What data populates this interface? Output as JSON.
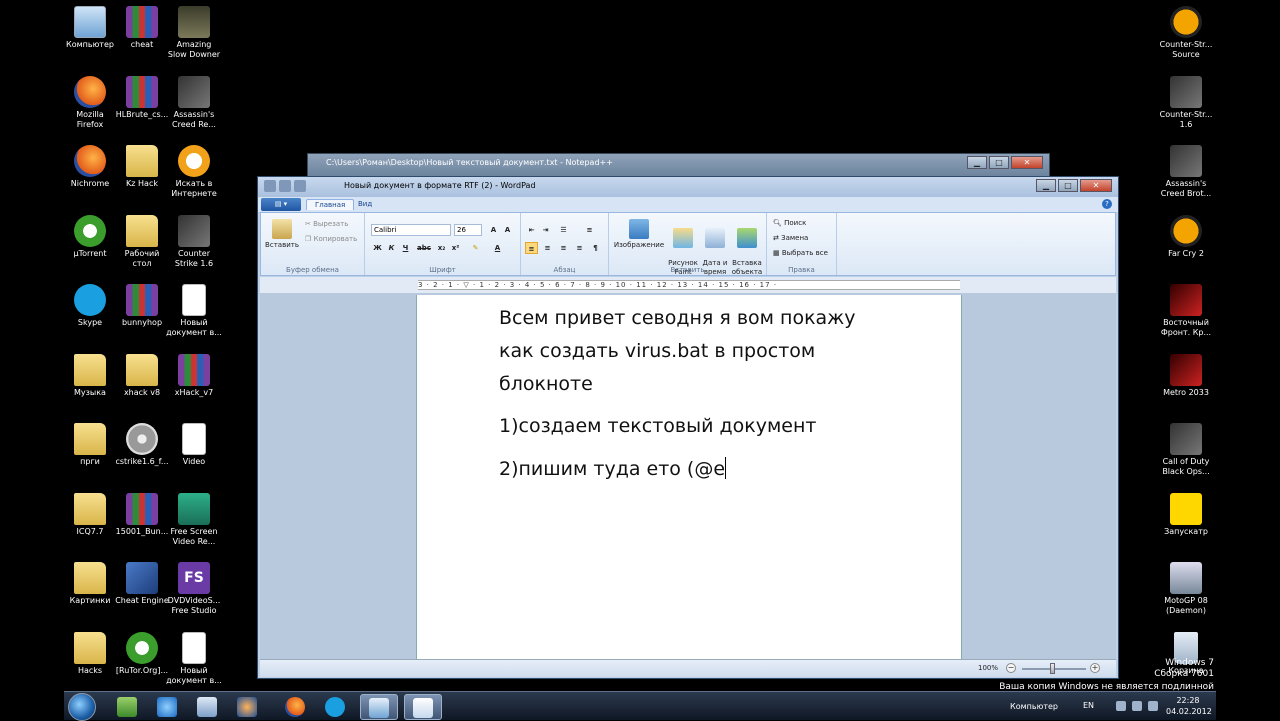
{
  "desktop_icons_left": [
    {
      "label": "Компьютер",
      "icon": "computer-icon"
    },
    {
      "label": "cheat",
      "icon": "winrar-archive-icon"
    },
    {
      "label": "Amazing\nSlow Downer",
      "icon": "amazing-slow-downer-icon"
    },
    {
      "label": "Mozilla\nFirefox",
      "icon": "firefox-icon"
    },
    {
      "label": "HLBrute_cs...",
      "icon": "winrar-archive-icon"
    },
    {
      "label": "Assassin's\nCreed Re...",
      "icon": "assassins-creed-icon"
    },
    {
      "label": "Nichrome",
      "icon": "nichrome-icon"
    },
    {
      "label": "Kz Hack",
      "icon": "folder-icon"
    },
    {
      "label": "Искать в\nИнтернете",
      "icon": "search-web-icon"
    },
    {
      "label": "µTorrent",
      "icon": "utorrent-icon"
    },
    {
      "label": "Рабочий\nстол",
      "icon": "folder-icon"
    },
    {
      "label": "Counter\nStrike 1.6",
      "icon": "counter-strike-icon"
    },
    {
      "label": "Skype",
      "icon": "skype-icon"
    },
    {
      "label": "bunnyhop",
      "icon": "winrar-archive-icon"
    },
    {
      "label": "Новый\nдокумент в...",
      "icon": "document-icon"
    },
    {
      "label": "Музыка",
      "icon": "folder-icon"
    },
    {
      "label": "xhack v8",
      "icon": "folder-icon"
    },
    {
      "label": "xHack_v7",
      "icon": "winrar-archive-icon"
    },
    {
      "label": "прги",
      "icon": "folder-icon"
    },
    {
      "label": "cstrike1.6_f...",
      "icon": "disc-icon"
    },
    {
      "label": "Video",
      "icon": "document-icon"
    },
    {
      "label": "ICQ7.7",
      "icon": "folder-icon"
    },
    {
      "label": "15001_Bun...",
      "icon": "winrar-archive-icon"
    },
    {
      "label": "Free Screen\nVideo Re...",
      "icon": "screen-recorder-icon"
    },
    {
      "label": "Картинки",
      "icon": "folder-icon"
    },
    {
      "label": "Cheat Engine",
      "icon": "cheat-engine-icon"
    },
    {
      "label": "DVDVideoS...\nFree Studio",
      "icon": "free-studio-icon"
    },
    {
      "label": "Hacks",
      "icon": "folder-icon"
    },
    {
      "label": "[RuTor.Org]...",
      "icon": "utorrent-icon"
    },
    {
      "label": "Новый\nдокумент в...",
      "icon": "document-icon"
    }
  ],
  "desktop_icons_right": [
    {
      "label": "Counter-Str...\nSource",
      "icon": "half-life-icon"
    },
    {
      "label": "Counter-Str...\n1.6",
      "icon": "counter-strike-icon"
    },
    {
      "label": "Assassin's\nCreed Brot...",
      "icon": "assassins-creed-icon"
    },
    {
      "label": "Far Cry 2",
      "icon": "far-cry-icon"
    },
    {
      "label": "Восточный\nФронт. Кр...",
      "icon": "game-icon"
    },
    {
      "label": "Metro 2033",
      "icon": "metro-icon"
    },
    {
      "label": "Call of Duty\nBlack Ops...",
      "icon": "call-of-duty-icon"
    },
    {
      "label": "Запускатр",
      "icon": "launcher-icon"
    },
    {
      "label": "MotoGP 08\n(Daemon)",
      "icon": "motogp-icon"
    },
    {
      "label": "Корзина",
      "icon": "recycle-bin-icon"
    }
  ],
  "notepad": {
    "title": "C:\\Users\\Роман\\Desktop\\Новый текстовый документ.txt - Notepad++"
  },
  "wordpad": {
    "title": "Новый документ в формате RTF (2) - WordPad",
    "tabs": [
      "Главная",
      "Вид"
    ],
    "clipboard": {
      "paste": "Вставить",
      "cut": "Вырезать",
      "copy": "Копировать",
      "group": "Буфер обмена"
    },
    "font": {
      "family": "Calibri",
      "size": "26",
      "group": "Шрифт",
      "bold": "Ж",
      "italic": "К",
      "underline": "Ч",
      "strike": "abc",
      "sub": "x₂",
      "sup": "x²"
    },
    "paragraph": {
      "group": "Абзац"
    },
    "insert": {
      "picture": "Изображение",
      "paint": "Рисунок\nPaint",
      "datetime": "Дата и\nвремя",
      "object": "Вставка\nобъекта",
      "group": "Вставить"
    },
    "editing": {
      "find": "Поиск",
      "replace": "Замена",
      "select_all": "Выбрать все",
      "group": "Правка"
    },
    "ruler": "3 · 2 · 1 · ▽ · 1 · 2 · 3 · 4 · 5 · 6 · 7 · 8 · 9 · 10 · 11 · 12 · 13 · 14 · 15 · 16 · 17 ·",
    "document_lines": [
      "Всем привет севодня я вом покажу",
      "как создать virus.bat в простом",
      "блокноте",
      "1)создаем текстовый документ",
      "2)пишим туда ето (@е"
    ],
    "zoom": "100%"
  },
  "watermark": {
    "line1": "Windows 7",
    "line2": "Сборка 7601",
    "line3": "Ваша копия Windows не является подлинной"
  },
  "taskbar": {
    "items": [
      "explorer-icon",
      "ie-icon",
      "control-panel-icon",
      "media-player-icon",
      "firefox-icon",
      "skype-icon",
      "paint-icon",
      "wordpad-icon"
    ],
    "tray_label": "Компьютер",
    "lang": "EN",
    "time": "22:28",
    "date": "04.02.2012"
  }
}
